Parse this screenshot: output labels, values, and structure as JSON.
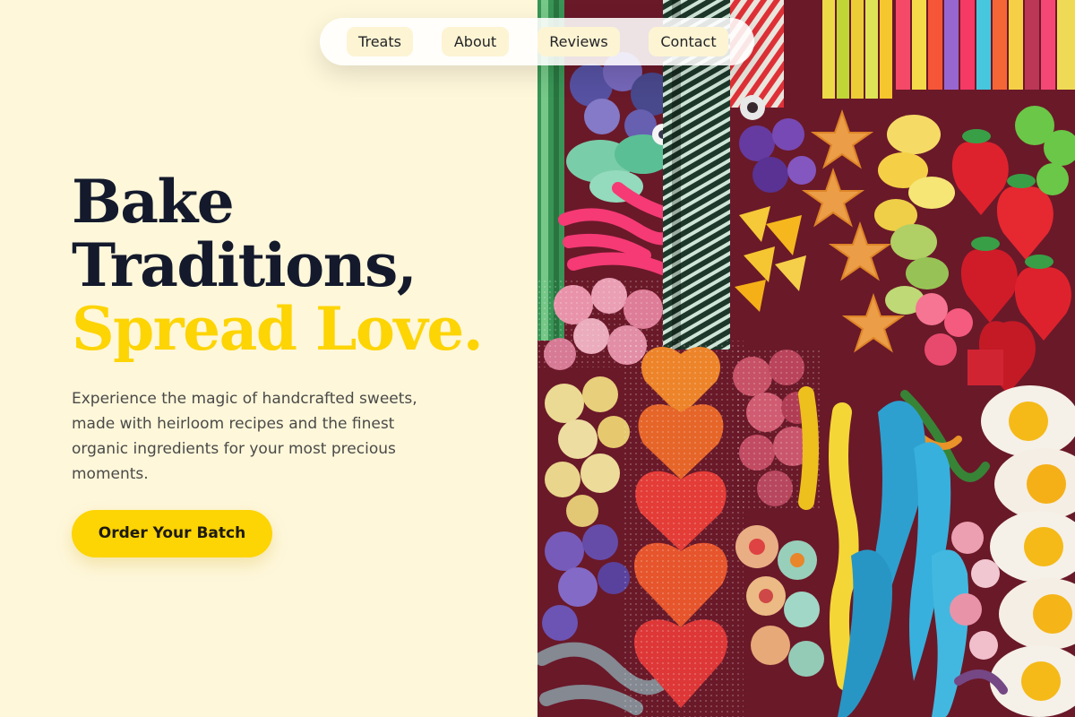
{
  "nav": {
    "items": [
      {
        "label": "Treats"
      },
      {
        "label": "About"
      },
      {
        "label": "Reviews"
      },
      {
        "label": "Contact"
      }
    ]
  },
  "hero": {
    "headline_line1": "Bake",
    "headline_line2": "Traditions,",
    "headline_accent": "Spread Love.",
    "subtitle": "Experience the magic of handcrafted sweets, made with heirloom recipes and the finest organic ingredients for your most precious moments.",
    "cta_label": "Order Your Batch"
  },
  "colors": {
    "background": "#fef7da",
    "accent": "#fdd404",
    "headline": "#141a2c",
    "body_text": "#4a4a48"
  },
  "image": {
    "subject": "candy-assortment-photo"
  }
}
